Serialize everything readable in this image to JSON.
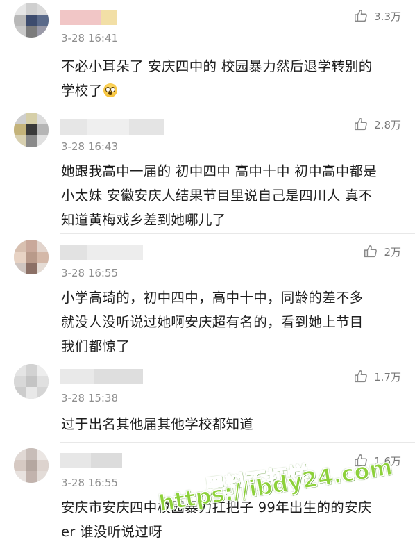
{
  "comments": [
    {
      "time": "3-28 16:41",
      "likes": "3.3万",
      "text_lines": [
        "不必小耳朵了 安庆四中的 校园暴力然后退学转别的",
        "学校了"
      ],
      "emoji": "astonished-face"
    },
    {
      "time": "3-28 16:43",
      "likes": "2.8万",
      "text_lines": [
        "她跟我高中一届的 初中四中 高中十中 初中高中都是",
        "小太妹 安徽安庆人结果节目里说自己是四川人 真不",
        "知道黄梅戏乡差到她哪儿了"
      ]
    },
    {
      "time": "3-28 16:55",
      "likes": "2万",
      "text_lines": [
        "小学高琦的，初中四中，高中十中，同龄的差不多",
        "就没人没听说过她啊安庆超有名的，看到她上节目",
        "我们都惊了"
      ]
    },
    {
      "time": "3-28 15:38",
      "likes": "1.7万",
      "text_lines": [
        "过于出名其他届其他学校都知道"
      ]
    },
    {
      "time": "3-28 16:55",
      "likes": "1.6万",
      "text_lines": [
        "安庆市安庆四中校园暴力扛把子 99年出生的的安庆",
        "er 谁没听说过呀"
      ]
    }
  ],
  "watermark": {
    "line1": "黑料不打烊",
    "line2": "https://ibdy24.com"
  },
  "colors": {
    "text": "#1e1e1e",
    "meta": "#8e8e8e",
    "watermark": "#8dd13a"
  }
}
